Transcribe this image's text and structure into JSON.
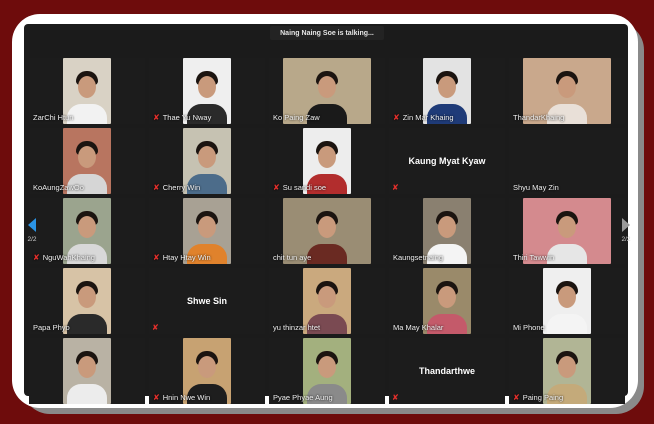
{
  "banner": {
    "talking": "Naing Naing Soe is talking..."
  },
  "navigation": {
    "left_page": "2/2",
    "right_page": "2/2"
  },
  "participants": [
    {
      "name": "ZarChi Htun",
      "muted": false,
      "video": true,
      "bg": "#d9d2c5",
      "shirt": "#f2f2f2"
    },
    {
      "name": "Thae Yu Nway",
      "muted": true,
      "video": true,
      "bg": "#efefef",
      "shirt": "#2a2a2a"
    },
    {
      "name": "Ko Paing Zaw",
      "muted": false,
      "video": true,
      "bg": "#b8a88a",
      "shirt": "#1a1a1a",
      "wide": true
    },
    {
      "name": "Zin Mar Khaing",
      "muted": true,
      "video": true,
      "bg": "#e3e3e3",
      "shirt": "#1f3b78"
    },
    {
      "name": "ThandarKhaing",
      "muted": false,
      "video": true,
      "bg": "#c9a88c",
      "shirt": "#e9e0d8",
      "wide": true
    },
    {
      "name": "KoAungZawOo",
      "muted": false,
      "video": true,
      "bg": "#b87560",
      "shirt": "#d6d6d6"
    },
    {
      "name": "Cherry Win",
      "muted": true,
      "video": true,
      "bg": "#c6c2b2",
      "shirt": "#4c6c8a"
    },
    {
      "name": "Su sandi soe",
      "muted": true,
      "video": true,
      "bg": "#ededed",
      "shirt": "#b22d2d"
    },
    {
      "name": "Kaung Myat Kyaw",
      "muted": true,
      "video": false
    },
    {
      "name": "Shyu May Zin",
      "muted": false,
      "video": false,
      "blank": true
    },
    {
      "name": "NguWahKhaing",
      "muted": true,
      "video": true,
      "bg": "#9ba48e",
      "shirt": "#d8d8d8"
    },
    {
      "name": "Htay Htay Win",
      "muted": true,
      "video": true,
      "bg": "#a8a194",
      "shirt": "#e0822c"
    },
    {
      "name": "chit tun aye",
      "muted": false,
      "video": true,
      "bg": "#9a8d74",
      "shirt": "#6a2a22",
      "wide": true
    },
    {
      "name": "Kaungsetnaing",
      "muted": false,
      "video": true,
      "bg": "#8a8070",
      "shirt": "#f4f4f4"
    },
    {
      "name": "Thiri Tawwin",
      "muted": false,
      "video": true,
      "bg": "#d48a8e",
      "shirt": "#e6e6e6",
      "wide": true
    },
    {
      "name": "Papa Phyo",
      "muted": false,
      "video": true,
      "bg": "#d7c3a6",
      "shirt": "#2a2a2a"
    },
    {
      "name": "Shwe Sin",
      "muted": true,
      "video": false
    },
    {
      "name": "yu thinzar htet",
      "muted": false,
      "video": true,
      "bg": "#caa97e",
      "shirt": "#7a4a52"
    },
    {
      "name": "Ma May Khalar",
      "muted": false,
      "video": true,
      "bg": "#9a8a6a",
      "shirt": "#c45a6a"
    },
    {
      "name": "Mi Phone",
      "muted": false,
      "video": true,
      "bg": "#efefef",
      "shirt": "#f4f4f4"
    },
    {
      "name": "",
      "muted": false,
      "video": true,
      "bg": "#b9b2a4",
      "shirt": "#ececec"
    },
    {
      "name": "Hnin Nwe Win",
      "muted": true,
      "video": true,
      "bg": "#c7a272",
      "shirt": "#1e1e1e"
    },
    {
      "name": "Pyae Phyae Aung",
      "muted": false,
      "video": true,
      "bg": "#a3b07e",
      "shirt": "#8a8a8a"
    },
    {
      "name": "Thandarthwe",
      "muted": true,
      "video": false
    },
    {
      "name": "Paing Paing",
      "muted": true,
      "video": true,
      "bg": "#b1b595",
      "shirt": "#c4aa7a"
    }
  ]
}
